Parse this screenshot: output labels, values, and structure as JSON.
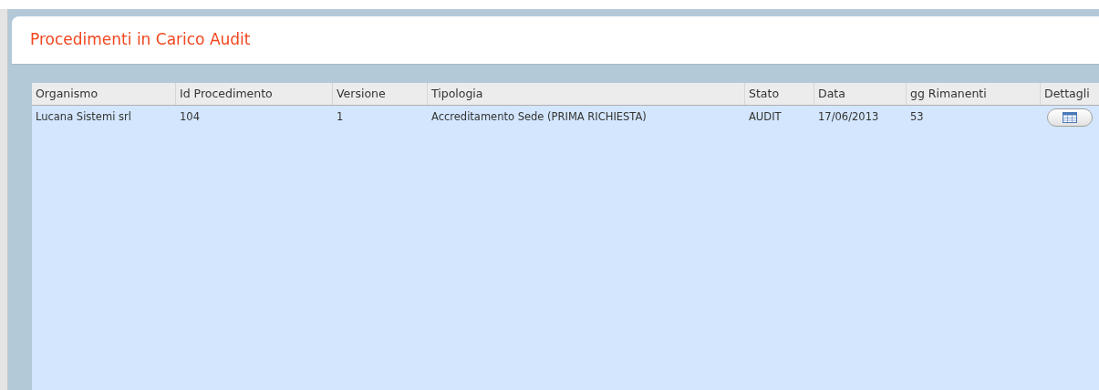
{
  "panel": {
    "title": "Procedimenti in Carico Audit"
  },
  "table": {
    "columns": [
      "Organismo",
      "Id Procedimento",
      "Versione",
      "Tipologia",
      "Stato",
      "Data",
      "gg Rimanenti",
      "Dettagli"
    ],
    "rows": [
      {
        "cells": [
          "Lucana Sistemi srl",
          "104",
          "1",
          "Accreditamento Sede (PRIMA RICHIESTA)",
          "AUDIT",
          "17/06/2013",
          "53"
        ],
        "selected": false
      }
    ]
  }
}
